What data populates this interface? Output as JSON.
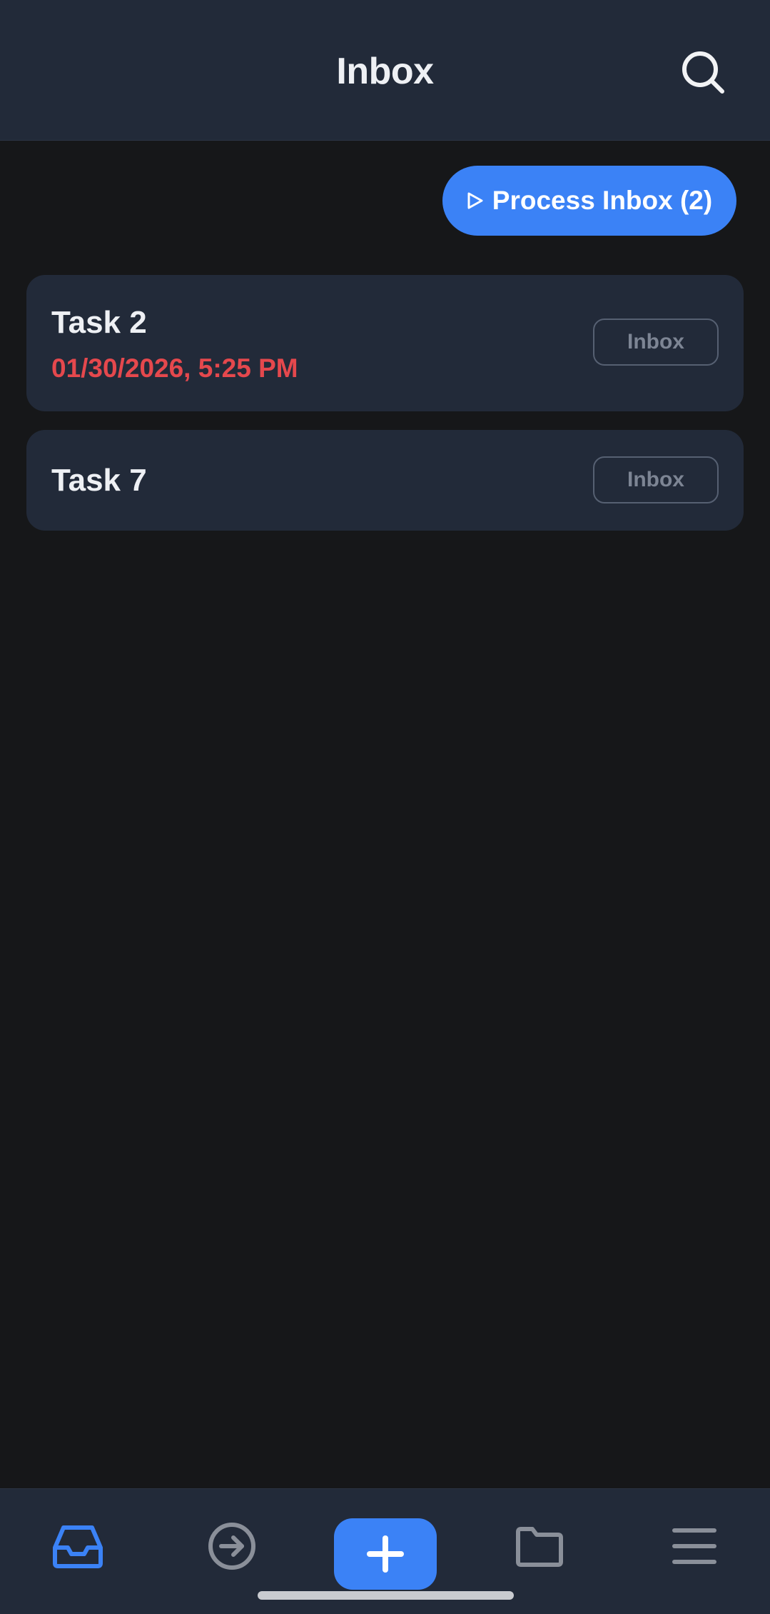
{
  "header": {
    "title": "Inbox",
    "search_icon": "search-icon"
  },
  "actions": {
    "process_label": "Process Inbox (2)",
    "process_icon": "play-icon"
  },
  "tasks": [
    {
      "title": "Task 2",
      "due": "01/30/2026, 5:25 PM",
      "tag": "Inbox"
    },
    {
      "title": "Task 7",
      "due": "",
      "tag": "Inbox"
    }
  ],
  "bottom_nav": {
    "items": [
      {
        "icon": "inbox-tray-icon",
        "active": true
      },
      {
        "icon": "arrow-right-circle-icon",
        "active": false
      },
      {
        "icon": "plus-icon",
        "active": false
      },
      {
        "icon": "folder-icon",
        "active": false
      },
      {
        "icon": "menu-icon",
        "active": false
      }
    ]
  },
  "colors": {
    "accent": "#3b82f6",
    "overdue": "#e5484d",
    "background": "#161719",
    "surface": "#222a39"
  }
}
